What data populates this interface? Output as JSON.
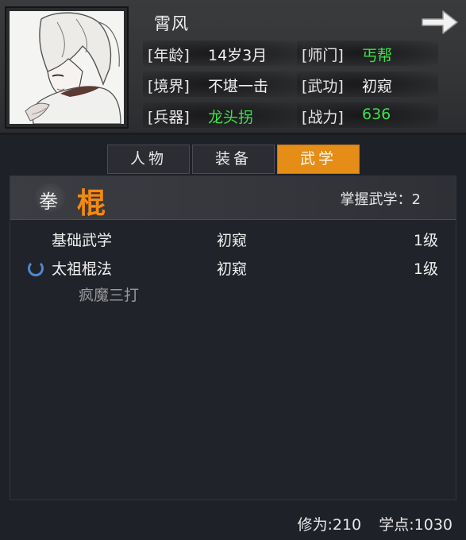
{
  "character": {
    "name": "霄风",
    "stats": [
      {
        "label": "[年龄]",
        "value": "14岁3月",
        "color": "white"
      },
      {
        "label": "[师门]",
        "value": "丐帮",
        "color": "green"
      },
      {
        "label": "[境界]",
        "value": "不堪一击",
        "color": "white"
      },
      {
        "label": "[武功]",
        "value": "初窥",
        "color": "white"
      },
      {
        "label": "[兵器]",
        "value": "龙头拐",
        "color": "green"
      },
      {
        "label": "[战力]",
        "value": "636",
        "color": "green"
      }
    ]
  },
  "tabs": [
    {
      "label": "人物",
      "active": false
    },
    {
      "label": "装备",
      "active": false
    },
    {
      "label": "武学",
      "active": true
    }
  ],
  "martial": {
    "categories": [
      "拳",
      "棍"
    ],
    "selected_category": "棍",
    "mastered_label": "掌握武学：2",
    "skills": [
      {
        "name": "基础武学",
        "rank": "初窥",
        "level": "1级",
        "learning": false
      },
      {
        "name": "太祖棍法",
        "rank": "初窥",
        "level": "1级",
        "learning": true
      }
    ],
    "sub_skill": "疯魔三打"
  },
  "footer": {
    "cultivation": "修为:210",
    "points": "学点:1030"
  },
  "colors": {
    "accent": "#e58d16",
    "green": "#3fe04a",
    "category_orange": "#f28a12",
    "spinner_blue": "#4d8ad0"
  },
  "icons": [
    "back-arrow-icon",
    "loading-spinner-icon"
  ]
}
